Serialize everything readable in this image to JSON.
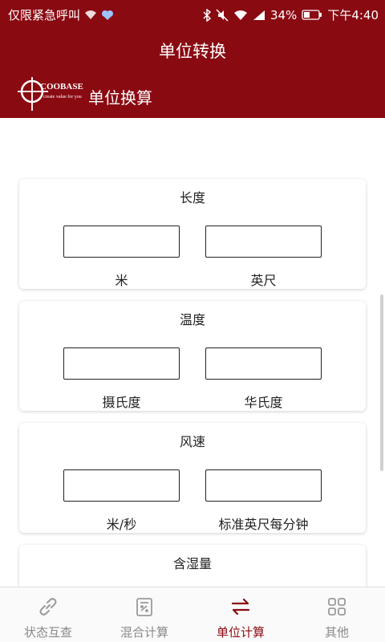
{
  "status_bar": {
    "carrier_text": "仅限紧急呼叫",
    "battery": "34%",
    "time": "下午4:40"
  },
  "header": {
    "title": "单位转换",
    "brand_name": "COOBASE",
    "brand_tagline": "create value for you",
    "subtitle": "单位换算"
  },
  "cards": [
    {
      "title": "长度",
      "left_unit": "米",
      "right_unit": "英尺",
      "left_value": "",
      "right_value": ""
    },
    {
      "title": "温度",
      "left_unit": "摄氏度",
      "right_unit": "华氏度",
      "left_value": "",
      "right_value": ""
    },
    {
      "title": "风速",
      "left_unit": "米/秒",
      "right_unit": "标准英尺每分钟",
      "left_value": "",
      "right_value": ""
    },
    {
      "title": "含湿量"
    }
  ],
  "nav": {
    "items": [
      {
        "label": "状态互查",
        "icon": "link-icon"
      },
      {
        "label": "混合计算",
        "icon": "calculator-icon"
      },
      {
        "label": "单位计算",
        "icon": "swap-arrows-icon",
        "active": true
      },
      {
        "label": "其他",
        "icon": "grid-icon"
      }
    ]
  },
  "colors": {
    "primary": "#8a0a12",
    "nav_inactive": "#888888"
  }
}
